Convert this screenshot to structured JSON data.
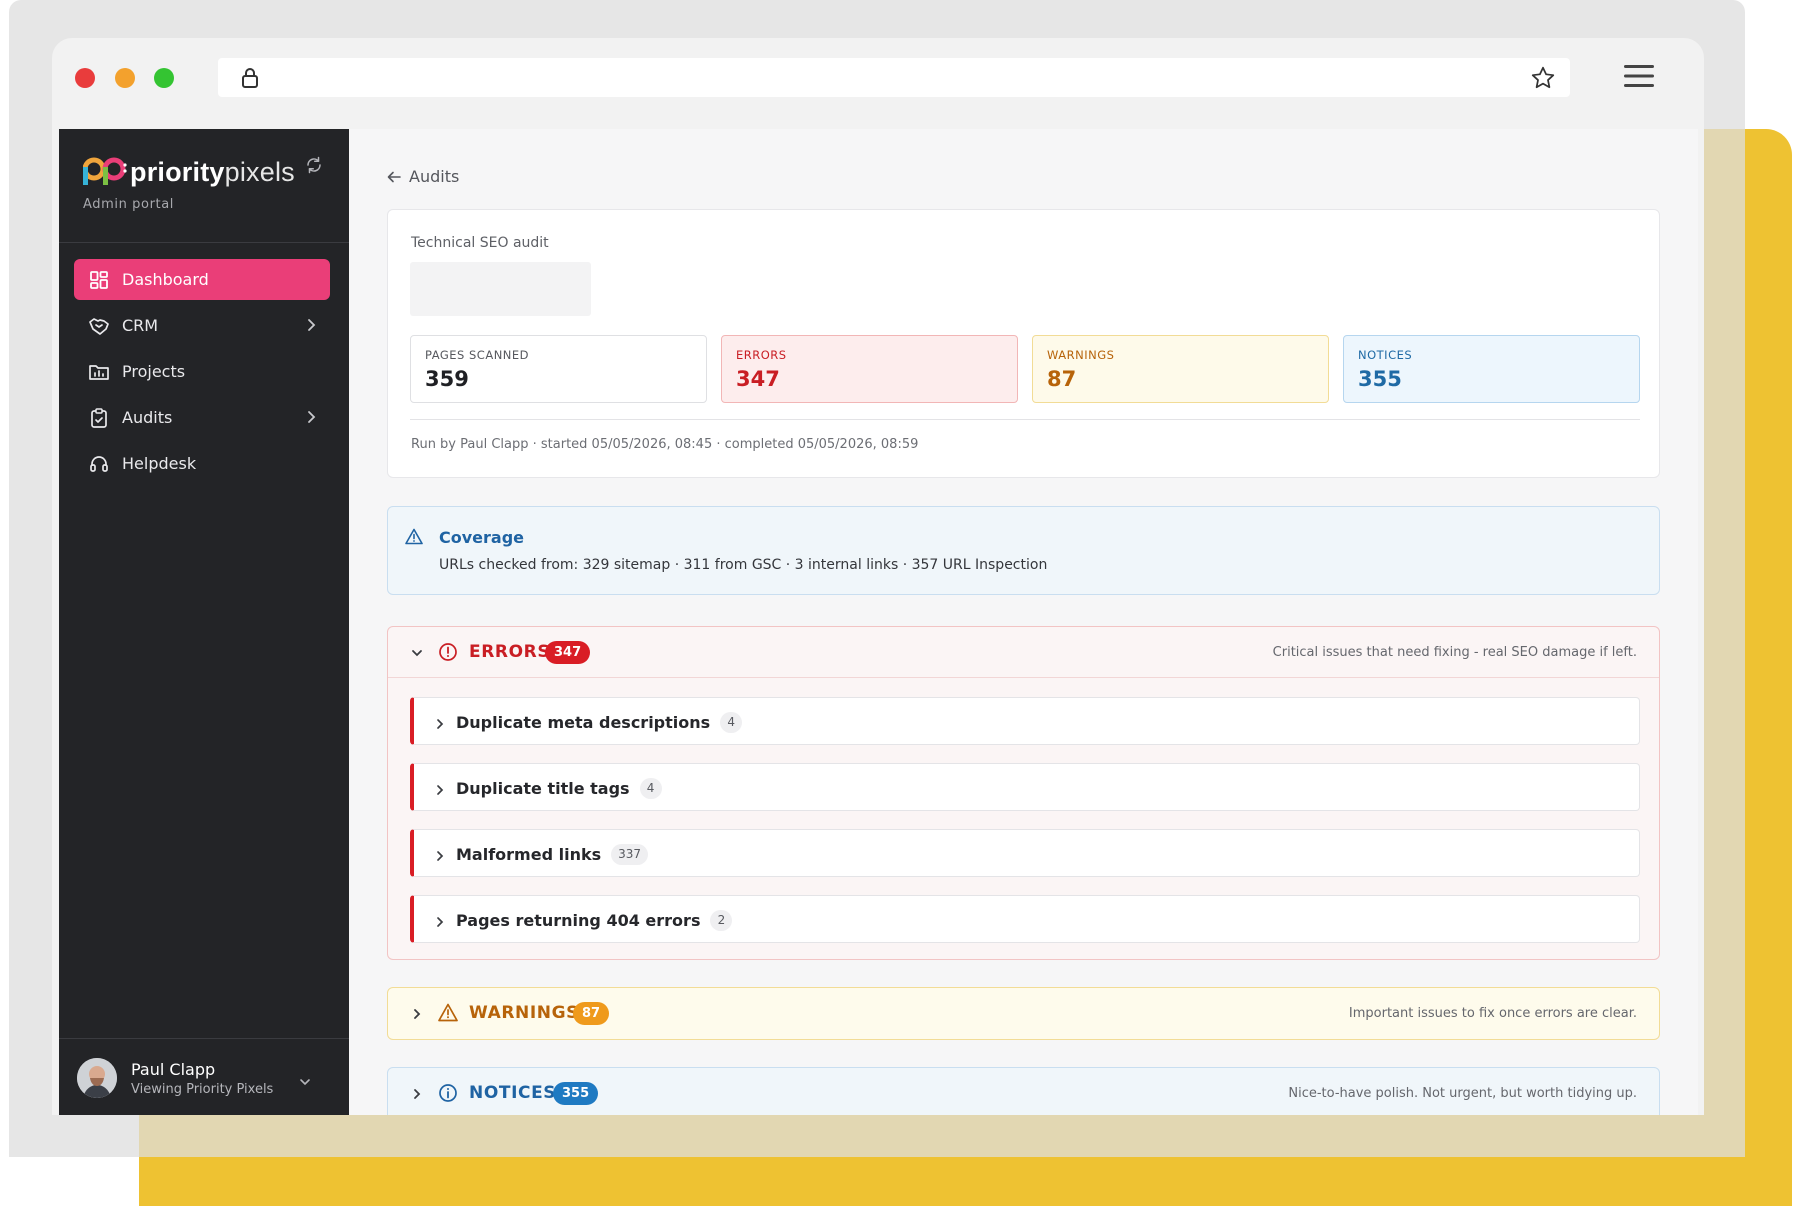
{
  "colors": {
    "accent": "#ea3e78",
    "sidebar_bg": "#232427",
    "error": "#d91d25",
    "warning": "#ef9a1c",
    "notice": "#1f7ac2",
    "deco_yellow": "#eec232"
  },
  "browser": {
    "lock_icon": "lock-icon",
    "star_icon": "star-icon",
    "menu_icon": "hamburger-menu-icon"
  },
  "sidebar": {
    "brand_bold": "priority",
    "brand_light": "pixels",
    "subtitle": "Admin portal",
    "items": [
      {
        "label": "Dashboard",
        "icon": "dashboard-icon",
        "active": true,
        "has_children": false
      },
      {
        "label": "CRM",
        "icon": "handshake-icon",
        "active": false,
        "has_children": true
      },
      {
        "label": "Projects",
        "icon": "folder-chart-icon",
        "active": false,
        "has_children": false
      },
      {
        "label": "Audits",
        "icon": "clipboard-check-icon",
        "active": false,
        "has_children": true
      },
      {
        "label": "Helpdesk",
        "icon": "headset-icon",
        "active": false,
        "has_children": false
      }
    ],
    "user": {
      "name": "Paul Clapp",
      "context": "Viewing Priority Pixels"
    }
  },
  "main": {
    "back_label": "Audits",
    "audit": {
      "type_label": "Technical SEO audit",
      "stats": [
        {
          "label": "PAGES SCANNED",
          "value": "359"
        },
        {
          "label": "ERRORS",
          "value": "347"
        },
        {
          "label": "WARNINGS",
          "value": "87"
        },
        {
          "label": "NOTICES",
          "value": "355"
        }
      ],
      "run_meta": "Run by Paul Clapp · started 05/05/2026, 08:45 · completed 05/05/2026, 08:59"
    },
    "coverage": {
      "title": "Coverage",
      "text": "URLs checked from: 329 sitemap · 311 from GSC · 3 internal links · 357 URL Inspection"
    },
    "errors": {
      "title": "ERRORS",
      "count": "347",
      "description": "Critical issues that need fixing - real SEO damage if left.",
      "expanded": true,
      "issues": [
        {
          "title": "Duplicate meta descriptions",
          "count": "4"
        },
        {
          "title": "Duplicate title tags",
          "count": "4"
        },
        {
          "title": "Malformed links",
          "count": "337"
        },
        {
          "title": "Pages returning 404 errors",
          "count": "2"
        }
      ]
    },
    "warnings": {
      "title": "WARNINGS",
      "count": "87",
      "description": "Important issues to fix once errors are clear.",
      "expanded": false
    },
    "notices": {
      "title": "NOTICES",
      "count": "355",
      "description": "Nice-to-have polish. Not urgent, but worth tidying up.",
      "expanded": false
    }
  }
}
